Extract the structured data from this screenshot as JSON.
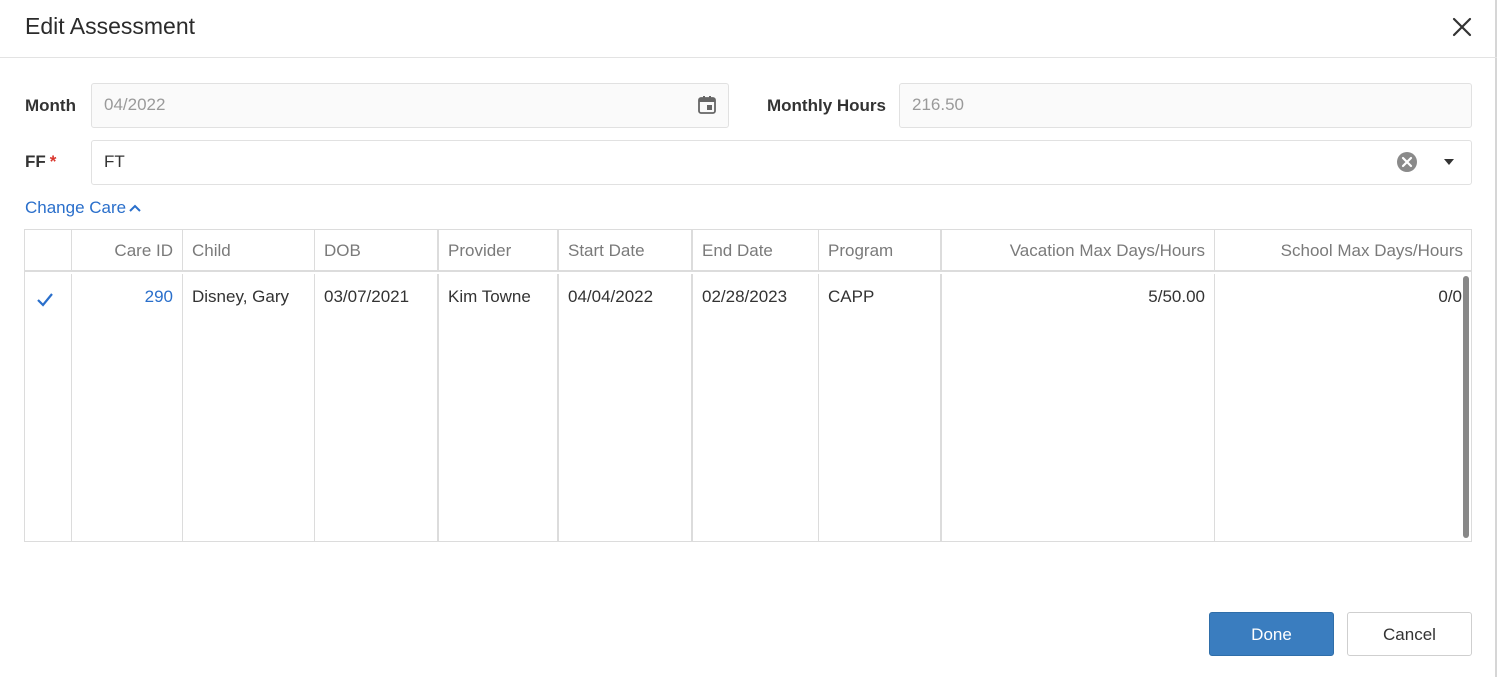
{
  "dialog": {
    "title": "Edit Assessment"
  },
  "form": {
    "month_label": "Month",
    "month_value": "04/2022",
    "monthly_hours_label": "Monthly Hours",
    "monthly_hours_value": "216.50",
    "ff_label": "FF",
    "ff_required_mark": "*",
    "ff_value": "FT"
  },
  "change_care": {
    "label": "Change Care"
  },
  "grid": {
    "columns": [
      "Care ID",
      "Child",
      "DOB",
      "Provider",
      "Start Date",
      "End Date",
      "Program",
      "Vacation Max Days/Hours",
      "School Max Days/Hours"
    ],
    "rows": [
      {
        "checked": true,
        "care_id": "290",
        "child": "Disney, Gary",
        "dob": "03/07/2021",
        "provider": "Kim Towne",
        "start_date": "04/04/2022",
        "end_date": "02/28/2023",
        "program": "CAPP",
        "vacation_max": "5/50.00",
        "school_max": "0/0"
      }
    ]
  },
  "buttons": {
    "done": "Done",
    "cancel": "Cancel"
  },
  "colors": {
    "primary": "#3a7dbf",
    "link": "#2a6fcb",
    "required": "#d9342b"
  }
}
